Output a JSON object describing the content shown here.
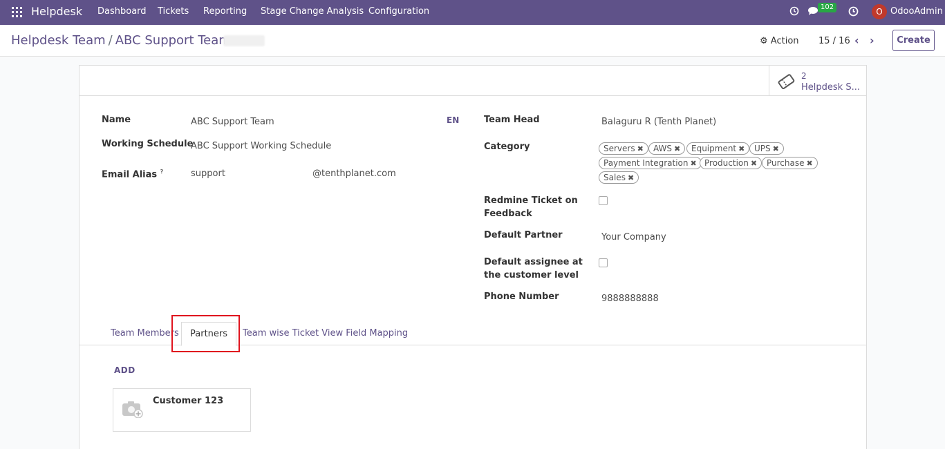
{
  "navbar": {
    "app_name": "Helpdesk",
    "menu": [
      "Dashboard",
      "Tickets",
      "Reporting",
      "Stage Change Analysis",
      "Configuration"
    ],
    "messages_count": "102",
    "user_initial": "O",
    "user_name": "OdooAdmin"
  },
  "control_panel": {
    "breadcrumb_parent": "Helpdesk Team",
    "breadcrumb_sep": "/",
    "breadcrumb_current": "ABC Support Team",
    "action_label": "Action",
    "pager": "15 / 16",
    "create_label": "Create"
  },
  "stat_button": {
    "count": "2",
    "label": "Helpdesk S..."
  },
  "form": {
    "left": {
      "name_label": "Name",
      "name_value": "ABC Support Team",
      "lang": "EN",
      "schedule_label": "Working Schedule",
      "schedule_value": "ABC Support Working Schedule",
      "alias_label": "Email Alias",
      "alias_help": "?",
      "alias_value": "support",
      "alias_domain": "@tenthplanet.com"
    },
    "right": {
      "team_head_label": "Team Head",
      "team_head_value": "Balaguru R (Tenth Planet)",
      "category_label": "Category",
      "categories": [
        "Servers",
        "AWS",
        "Equipment",
        "UPS",
        "Payment Integration",
        "Production",
        "Purchase",
        "Sales"
      ],
      "redmine_label": "Redmine Ticket on Feedback",
      "default_partner_label": "Default Partner",
      "default_partner_value": "Your Company",
      "default_assignee_label": "Default assignee at the customer level",
      "phone_label": "Phone Number",
      "phone_value": "9888888888"
    }
  },
  "tabs": [
    "Team Members",
    "Partners",
    "Team wise Ticket View Field Mapping"
  ],
  "partners": {
    "add_label": "ADD",
    "cards": [
      {
        "name": "Customer 123"
      }
    ]
  },
  "colors": {
    "navbar": "#5f5289",
    "accent": "#5f5289",
    "highlight": "#e0141e",
    "badge": "#28a745"
  }
}
